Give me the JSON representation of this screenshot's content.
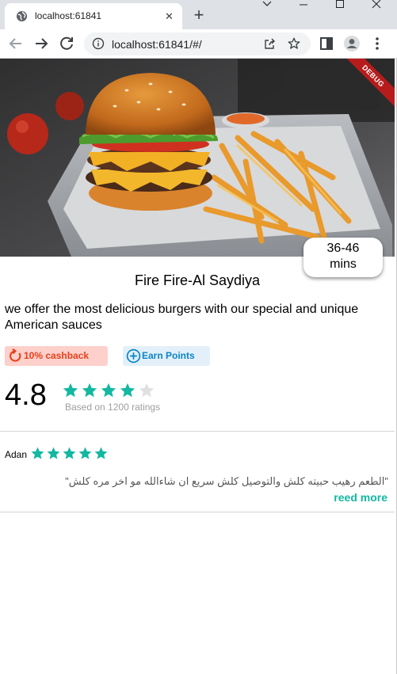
{
  "browser": {
    "tab_title": "localhost:61841",
    "url": "localhost:61841/#/",
    "tab_close_glyph": "✕",
    "newtab_glyph": "+"
  },
  "restaurant": {
    "debug_label": "DEBUG",
    "delivery_time_line1": "36-46",
    "delivery_time_line2": "mins",
    "name": "Fire Fire-Al Saydiya",
    "description": "we offer the most delicious burgers with our special and unique American sauces",
    "cashback_label": "10% cashback",
    "points_label": "Earn Points",
    "rating": "4.8",
    "rating_stars": 4,
    "rating_stars_max": 5,
    "rating_caption": "Based on 1200 ratings"
  },
  "review": {
    "author": "Adan",
    "stars": 5,
    "text": "\"الطعم رهيب حبيته كلش والتوصيل كلش سريع ان شاءالله مو اخر مره كلش\"",
    "read_more": "reed more"
  },
  "colors": {
    "accent_teal": "#12b8a0",
    "star_empty": "#e0e0e0",
    "cashback_bg": "#fdd0cb",
    "cashback_fg": "#e8401c",
    "points_bg": "#e3f0fa",
    "points_fg": "#0a85c7",
    "debug_banner": "#b71c1c"
  },
  "icons": {
    "favicon": "globe-icon",
    "back": "arrow-left-icon",
    "forward": "arrow-right-icon",
    "reload": "reload-icon",
    "info": "info-icon",
    "share": "share-icon",
    "bookmark": "star-outline-icon",
    "sidepanel": "side-panel-icon",
    "profile": "profile-icon",
    "menu": "kebab-menu-icon",
    "cashback": "refresh-icon",
    "points": "plus-circle-icon",
    "rating_star": "star-icon"
  }
}
